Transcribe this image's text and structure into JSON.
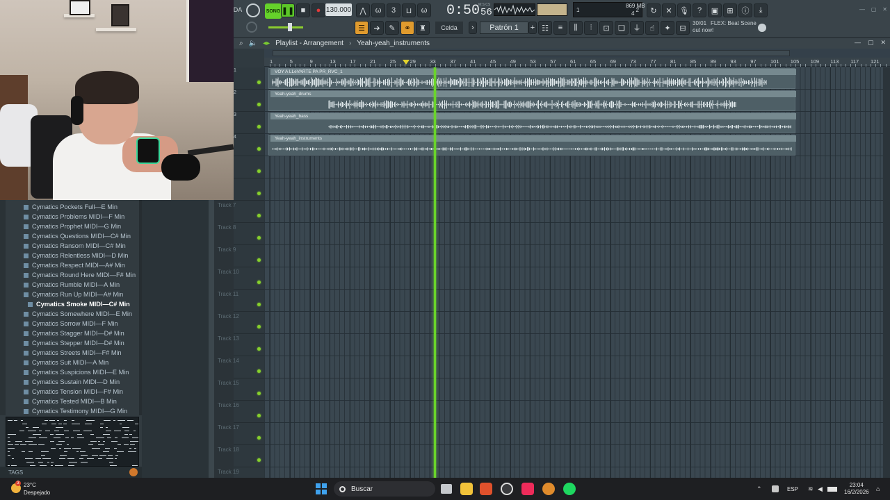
{
  "toolbar": {
    "song_toggle": "SONG",
    "tempo": "130.000",
    "time_main": "0:50",
    "time_sec": "56",
    "time_unit": "M:S:CS",
    "cpu_value": "1",
    "cpu_value2": "2",
    "memory": "869 MB",
    "polyphony": "4",
    "snap_label": "Celda",
    "pattern_label": "Patrón 1",
    "hint_date": "30/01",
    "hint_text": "FLEX: Beat Scene",
    "hint_text2": "out now!"
  },
  "playlist": {
    "title": "Playlist - Arrangement",
    "breadcrumb": "Yeah-yeah_instruments",
    "ruler_labels": [
      "1",
      "5",
      "9",
      "13",
      "17",
      "21",
      "25",
      "29",
      "33",
      "37",
      "41",
      "45",
      "49",
      "53",
      "57",
      "61",
      "65",
      "69",
      "73",
      "77",
      "81",
      "85",
      "89",
      "93",
      "97",
      "101",
      "105",
      "109",
      "113",
      "117",
      "121"
    ],
    "clips": [
      {
        "name": "VOY A LLeVARTE PA PR_RVC_1",
        "track": 1
      },
      {
        "name": "Yeah-yeah_drums",
        "track": 2
      },
      {
        "name": "Yeah-yeah_bass",
        "track": 3
      },
      {
        "name": "Yeah-yeah_instruments",
        "track": 4
      }
    ],
    "track_numbers": [
      "1",
      "2",
      "3",
      "4"
    ],
    "track_labels": [
      "Track 7",
      "Track 8",
      "Track 9",
      "Track 10",
      "Track 11",
      "Track 12",
      "Track 13",
      "Track 14",
      "Track 15",
      "Track 16",
      "Track 17",
      "Track 18",
      "Track 19"
    ]
  },
  "browser": {
    "items": [
      {
        "label": "Cymatics Pockets Full—E Min"
      },
      {
        "label": "Cymatics Problems MIDI—F Min"
      },
      {
        "label": "Cymatics Prophet MIDI—G Min"
      },
      {
        "label": "Cymatics Questions MIDI—C# Min"
      },
      {
        "label": "Cymatics Ransom MIDI—C# Min"
      },
      {
        "label": "Cymatics Relentless MIDI—D Min"
      },
      {
        "label": "Cymatics Respect MIDI—A# Min"
      },
      {
        "label": "Cymatics Round Here MIDI—F# Min"
      },
      {
        "label": "Cymatics Rumble MIDI—A Min"
      },
      {
        "label": "Cymatics Run Up MIDI—A# Min"
      },
      {
        "label": "Cymatics Smoke MIDI—C# Min",
        "selected": true
      },
      {
        "label": "Cymatics Somewhere MIDI—E Min"
      },
      {
        "label": "Cymatics Sorrow MIDI—F Min"
      },
      {
        "label": "Cymatics Stagger MIDI—D# Min"
      },
      {
        "label": "Cymatics Stepper MIDI—D# Min"
      },
      {
        "label": "Cymatics Streets MIDI—F# Min"
      },
      {
        "label": "Cymatics Suit MIDI—A Min"
      },
      {
        "label": "Cymatics Suspicions MIDI—E Min"
      },
      {
        "label": "Cymatics Sustain MIDI—D Min"
      },
      {
        "label": "Cymatics Tension MIDI—F# Min"
      },
      {
        "label": "Cymatics Tested MIDI—B Min"
      },
      {
        "label": "Cymatics Testimony MIDI—G Min"
      }
    ],
    "tags_label": "TAGS"
  },
  "taskbar": {
    "weather_badge": "3",
    "temperature": "23°C",
    "condition": "Despejado",
    "search_placeholder": "Buscar",
    "language": "ESP",
    "time": "23:04",
    "date": "16/2/2026"
  },
  "colors": {
    "accent_green": "#65d22a",
    "playhead": "#6ad42b",
    "clip_body": "#4e5f66",
    "clip_header": "#76898f"
  }
}
